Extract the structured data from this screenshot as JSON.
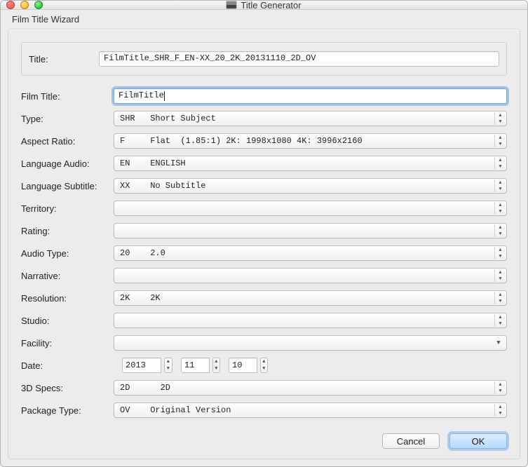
{
  "window": {
    "title": "Title Generator",
    "group_label": "Film Title Wizard",
    "buttons": {
      "cancel": "Cancel",
      "ok": "OK"
    }
  },
  "fields": {
    "title": {
      "label": "Title:",
      "value": "FilmTitle_SHR_F_EN-XX_20_2K_20131110_2D_OV"
    },
    "film_title": {
      "label": "Film Title:",
      "value": "FilmTitle"
    },
    "type": {
      "label": "Type:",
      "value": "SHR   Short Subject"
    },
    "aspect_ratio": {
      "label": "Aspect Ratio:",
      "value": "F     Flat  (1.85:1) 2K: 1998x1080 4K: 3996x2160"
    },
    "language_audio": {
      "label": "Language Audio:",
      "value": "EN    ENGLISH"
    },
    "language_subtitle": {
      "label": "Language Subtitle:",
      "value": "XX    No Subtitle"
    },
    "territory": {
      "label": "Territory:",
      "value": ""
    },
    "rating": {
      "label": "Rating:",
      "value": ""
    },
    "audio_type": {
      "label": "Audio Type:",
      "value": "20    2.0"
    },
    "narrative": {
      "label": "Narrative:",
      "value": ""
    },
    "resolution": {
      "label": "Resolution:",
      "value": "2K    2K"
    },
    "studio": {
      "label": "Studio:",
      "value": ""
    },
    "facility": {
      "label": "Facility:",
      "value": ""
    },
    "date": {
      "label": "Date:",
      "year": "2013",
      "month": "11",
      "day": "10"
    },
    "specs_3d": {
      "label": "3D Specs:",
      "value": "2D      2D"
    },
    "package_type": {
      "label": "Package Type:",
      "value": "OV    Original Version"
    }
  }
}
